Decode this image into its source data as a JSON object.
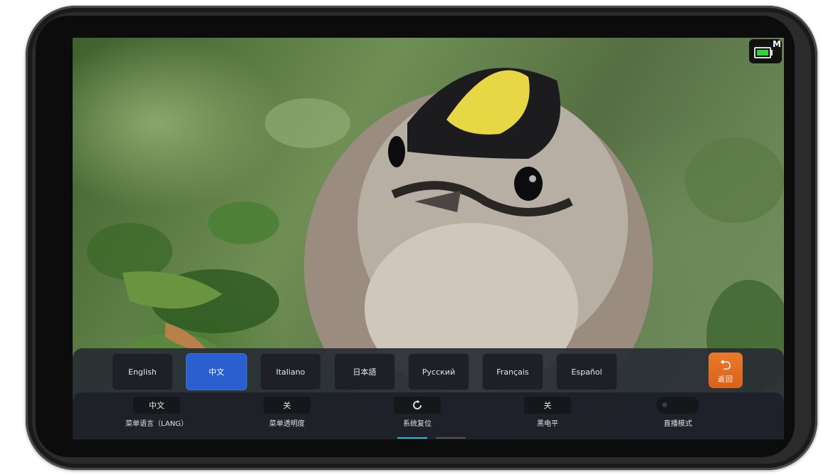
{
  "status": {
    "mode_letter": "M",
    "battery_icon": "battery-icon"
  },
  "languages": [
    {
      "label": "English",
      "active": false
    },
    {
      "label": "中文",
      "active": true
    },
    {
      "label": "Italiano",
      "active": false
    },
    {
      "label": "日本語",
      "active": false
    },
    {
      "label": "Русский",
      "active": false
    },
    {
      "label": "Français",
      "active": false
    },
    {
      "label": "Español",
      "active": false
    }
  ],
  "back_button": {
    "icon": "return-arrow-icon",
    "label": "返回"
  },
  "settings": {
    "language": {
      "value": "中文",
      "name": "菜单语言（LANG）"
    },
    "transparency": {
      "value": "关",
      "name": "菜单透明度"
    },
    "reset": {
      "icon": "refresh-icon",
      "name": "系统复位"
    },
    "black_level": {
      "value": "关",
      "name": "黑电平"
    },
    "live_mode": {
      "name": "直播模式",
      "state": "off"
    }
  },
  "colors": {
    "accent": "#2b5fcf",
    "back_button": "#e06c22",
    "indicator": "#2eb8d1"
  }
}
